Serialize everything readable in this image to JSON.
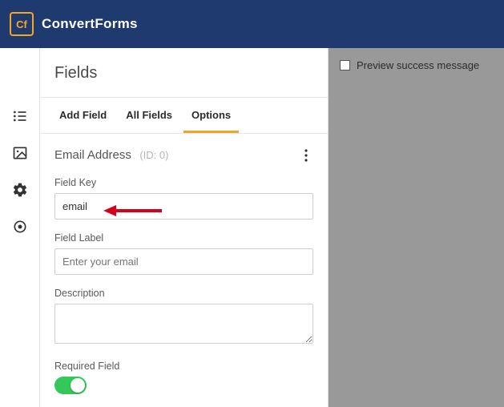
{
  "brand": {
    "logo_letters": "Cf",
    "name": "ConvertForms"
  },
  "panel": {
    "title": "Fields"
  },
  "tabs": {
    "add_field": "Add Field",
    "all_fields": "All Fields",
    "options": "Options"
  },
  "field": {
    "title": "Email Address",
    "id_label": "(ID: 0)",
    "key_label": "Field Key",
    "key_value": "email",
    "label_label": "Field Label",
    "label_placeholder": "Enter your email",
    "description_label": "Description",
    "description_value": "",
    "required_label": "Required Field"
  },
  "preview": {
    "success_label": "Preview success message"
  },
  "colors": {
    "header_bg": "#1e3a6e",
    "accent": "#efa52b",
    "toggle_on": "#34c759",
    "annotation": "#d7001a"
  }
}
